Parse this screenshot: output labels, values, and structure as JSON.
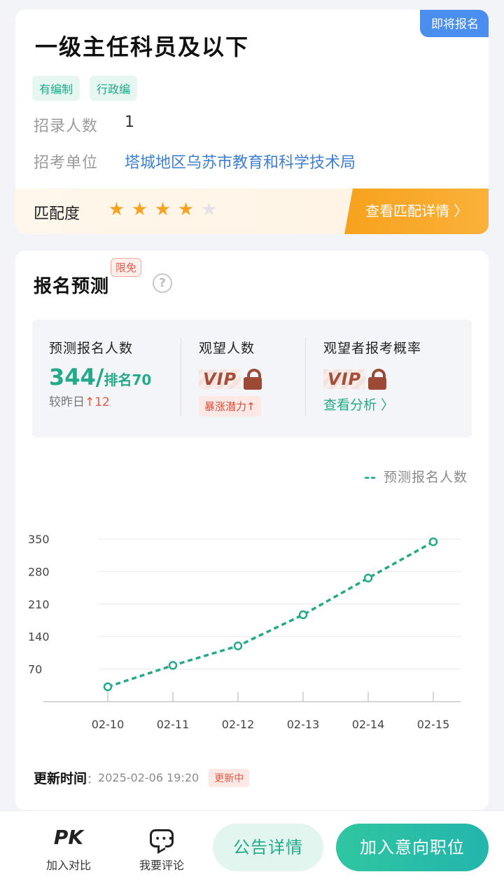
{
  "job": {
    "status_badge": "即将报名",
    "title": "一级主任科员及以下",
    "tags": [
      "有编制",
      "行政编"
    ],
    "count_label": "招录人数",
    "count_value": "1",
    "unit_label": "招考单位",
    "unit_value": "塔城地区乌苏市教育和科学技术局"
  },
  "match": {
    "label": "匹配度",
    "rating": 4,
    "max_rating": 5,
    "detail_button": "查看匹配详情 〉",
    "accent": "#f7a21d"
  },
  "forecast": {
    "title": "报名预测",
    "limit_badge": "限免",
    "help_icon": "?",
    "stat1_title": "预测报名人数",
    "stat1_value": "344/",
    "stat1_rank": "排名70",
    "stat1_sub_prefix": "较昨日",
    "stat1_sub_delta": "↑12",
    "stat2_title": "观望人数",
    "stat2_vip": "VIP",
    "stat2_badge": "暴涨潜力↑",
    "stat3_title": "观望者报考概率",
    "stat3_vip": "VIP",
    "stat3_link": "查看分析 〉",
    "legend_dash": "--",
    "legend_label": "预测报名人数",
    "update_label": "更新时间",
    "update_sep": "：",
    "update_value": "2025-02-06 19:20",
    "update_badge": "更新中"
  },
  "chart_data": {
    "type": "line",
    "x": [
      "02-10",
      "02-11",
      "02-12",
      "02-13",
      "02-14",
      "02-15"
    ],
    "yticks": [
      70,
      140,
      210,
      280,
      350
    ],
    "ylim": [
      0,
      350
    ],
    "series": [
      {
        "name": "预测报名人数",
        "values": [
          32,
          78,
          120,
          187,
          266,
          344
        ],
        "color": "#24a98a"
      }
    ],
    "grid": true,
    "legend": "top-right"
  },
  "bottom": {
    "pk_icon_text": "PK",
    "compare_label": "加入对比",
    "comment_label": "我要评论",
    "notice_button": "公告详情",
    "add_button": "加入意向职位"
  }
}
